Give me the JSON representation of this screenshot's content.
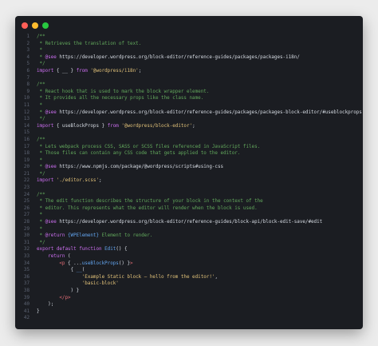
{
  "window": {
    "background": "#1b1d22",
    "controls": [
      {
        "name": "close-button",
        "color": "#ff5f57"
      },
      {
        "name": "minimize-button",
        "color": "#febc2e"
      },
      {
        "name": "maximize-button",
        "color": "#28c840"
      }
    ]
  },
  "colors": {
    "linenum": "#5d6473",
    "plain": "#d6dbe3",
    "comment": "#62a85c",
    "keyword": "#cc6ff0",
    "string": "#e2c279",
    "func": "#62a4ee",
    "tag": "#e26d76",
    "url": "#d6dbe3",
    "tagdoc": "#cc6ff0",
    "type": "#62a4ee"
  },
  "lines": [
    {
      "n": "1",
      "tokens": [
        {
          "t": "/**",
          "c": "comment"
        }
      ]
    },
    {
      "n": "2",
      "tokens": [
        {
          "t": " * Retrieves the translation of text.",
          "c": "comment"
        }
      ]
    },
    {
      "n": "3",
      "tokens": [
        {
          "t": " *",
          "c": "comment"
        }
      ]
    },
    {
      "n": "4",
      "tokens": [
        {
          "t": " * ",
          "c": "comment"
        },
        {
          "t": "@see",
          "c": "tagdoc"
        },
        {
          "t": " https://developer.wordpress.org/block-editor/reference-guides/packages/packages-i18n/",
          "c": "url"
        }
      ]
    },
    {
      "n": "5",
      "tokens": [
        {
          "t": " */",
          "c": "comment"
        }
      ]
    },
    {
      "n": "6",
      "tokens": [
        {
          "t": "import",
          "c": "keyword"
        },
        {
          "t": " { __ } ",
          "c": "plain"
        },
        {
          "t": "from",
          "c": "keyword"
        },
        {
          "t": " ",
          "c": "plain"
        },
        {
          "t": "'@wordpress/i18n'",
          "c": "string"
        },
        {
          "t": ";",
          "c": "plain"
        }
      ]
    },
    {
      "n": "7",
      "tokens": []
    },
    {
      "n": "8",
      "tokens": [
        {
          "t": "/**",
          "c": "comment"
        }
      ]
    },
    {
      "n": "9",
      "tokens": [
        {
          "t": " * React hook that is used to mark the block wrapper element.",
          "c": "comment"
        }
      ]
    },
    {
      "n": "10",
      "tokens": [
        {
          "t": " * It provides all the necessary props like the class name.",
          "c": "comment"
        }
      ]
    },
    {
      "n": "11",
      "tokens": [
        {
          "t": " *",
          "c": "comment"
        }
      ]
    },
    {
      "n": "12",
      "tokens": [
        {
          "t": " * ",
          "c": "comment"
        },
        {
          "t": "@see",
          "c": "tagdoc"
        },
        {
          "t": " https://developer.wordpress.org/block-editor/reference-guides/packages/packages-block-editor/#useblockprops",
          "c": "url"
        }
      ]
    },
    {
      "n": "13",
      "tokens": [
        {
          "t": " */",
          "c": "comment"
        }
      ]
    },
    {
      "n": "14",
      "tokens": [
        {
          "t": "import",
          "c": "keyword"
        },
        {
          "t": " { useBlockProps } ",
          "c": "plain"
        },
        {
          "t": "from",
          "c": "keyword"
        },
        {
          "t": " ",
          "c": "plain"
        },
        {
          "t": "'@wordpress/block-editor'",
          "c": "string"
        },
        {
          "t": ";",
          "c": "plain"
        }
      ]
    },
    {
      "n": "15",
      "tokens": []
    },
    {
      "n": "16",
      "tokens": [
        {
          "t": "/**",
          "c": "comment"
        }
      ]
    },
    {
      "n": "17",
      "tokens": [
        {
          "t": " * Lets webpack process CSS, SASS or SCSS files referenced in JavaScript files.",
          "c": "comment"
        }
      ]
    },
    {
      "n": "18",
      "tokens": [
        {
          "t": " * Those files can contain any CSS code that gets applied to the editor.",
          "c": "comment"
        }
      ]
    },
    {
      "n": "19",
      "tokens": [
        {
          "t": " *",
          "c": "comment"
        }
      ]
    },
    {
      "n": "20",
      "tokens": [
        {
          "t": " * ",
          "c": "comment"
        },
        {
          "t": "@see",
          "c": "tagdoc"
        },
        {
          "t": " https://www.npmjs.com/package/@wordpress/scripts#using-css",
          "c": "url"
        }
      ]
    },
    {
      "n": "21",
      "tokens": [
        {
          "t": " */",
          "c": "comment"
        }
      ]
    },
    {
      "n": "22",
      "tokens": [
        {
          "t": "import",
          "c": "keyword"
        },
        {
          "t": " ",
          "c": "plain"
        },
        {
          "t": "'./editor.scss'",
          "c": "string"
        },
        {
          "t": ";",
          "c": "plain"
        }
      ]
    },
    {
      "n": "23",
      "tokens": []
    },
    {
      "n": "24",
      "tokens": [
        {
          "t": "/**",
          "c": "comment"
        }
      ]
    },
    {
      "n": "25",
      "tokens": [
        {
          "t": " * The edit function describes the structure of your block in the context of the",
          "c": "comment"
        }
      ]
    },
    {
      "n": "26",
      "tokens": [
        {
          "t": " * editor. This represents what the editor will render when the block is used.",
          "c": "comment"
        }
      ]
    },
    {
      "n": "27",
      "tokens": [
        {
          "t": " *",
          "c": "comment"
        }
      ]
    },
    {
      "n": "28",
      "tokens": [
        {
          "t": " * ",
          "c": "comment"
        },
        {
          "t": "@see",
          "c": "tagdoc"
        },
        {
          "t": " https://developer.wordpress.org/block-editor/reference-guides/block-api/block-edit-save/#edit",
          "c": "url"
        }
      ]
    },
    {
      "n": "29",
      "tokens": [
        {
          "t": " *",
          "c": "comment"
        }
      ]
    },
    {
      "n": "30",
      "tokens": [
        {
          "t": " * ",
          "c": "comment"
        },
        {
          "t": "@return",
          "c": "tagdoc"
        },
        {
          "t": " ",
          "c": "comment"
        },
        {
          "t": "{WPElement}",
          "c": "type"
        },
        {
          "t": " Element to render.",
          "c": "comment"
        }
      ]
    },
    {
      "n": "31",
      "tokens": [
        {
          "t": " */",
          "c": "comment"
        }
      ]
    },
    {
      "n": "32",
      "tokens": [
        {
          "t": "export",
          "c": "keyword"
        },
        {
          "t": " ",
          "c": "plain"
        },
        {
          "t": "default",
          "c": "keyword"
        },
        {
          "t": " ",
          "c": "plain"
        },
        {
          "t": "function",
          "c": "keyword"
        },
        {
          "t": " ",
          "c": "plain"
        },
        {
          "t": "Edit",
          "c": "func"
        },
        {
          "t": "() {",
          "c": "plain"
        }
      ]
    },
    {
      "n": "33",
      "tokens": [
        {
          "t": "    ",
          "c": "plain"
        },
        {
          "t": "return",
          "c": "keyword"
        },
        {
          "t": " (",
          "c": "plain"
        }
      ]
    },
    {
      "n": "34",
      "tokens": [
        {
          "t": "        ",
          "c": "plain"
        },
        {
          "t": "<p",
          "c": "tag"
        },
        {
          "t": " { ...",
          "c": "plain"
        },
        {
          "t": "useBlockProps",
          "c": "func"
        },
        {
          "t": "() }",
          "c": "plain"
        },
        {
          "t": ">",
          "c": "tag"
        }
      ]
    },
    {
      "n": "35",
      "tokens": [
        {
          "t": "            { ",
          "c": "plain"
        },
        {
          "t": "__",
          "c": "func"
        },
        {
          "t": "(",
          "c": "plain"
        }
      ]
    },
    {
      "n": "36",
      "tokens": [
        {
          "t": "                ",
          "c": "plain"
        },
        {
          "t": "'Example Static block – hello from the editor!'",
          "c": "string"
        },
        {
          "t": ",",
          "c": "plain"
        }
      ]
    },
    {
      "n": "37",
      "tokens": [
        {
          "t": "                ",
          "c": "plain"
        },
        {
          "t": "'basic-block'",
          "c": "string"
        }
      ]
    },
    {
      "n": "38",
      "tokens": [
        {
          "t": "            ) }",
          "c": "plain"
        }
      ]
    },
    {
      "n": "39",
      "tokens": [
        {
          "t": "        ",
          "c": "plain"
        },
        {
          "t": "</p>",
          "c": "tag"
        }
      ]
    },
    {
      "n": "40",
      "tokens": [
        {
          "t": "    );",
          "c": "plain"
        }
      ]
    },
    {
      "n": "41",
      "tokens": [
        {
          "t": "}",
          "c": "plain"
        }
      ]
    },
    {
      "n": "42",
      "tokens": []
    }
  ]
}
